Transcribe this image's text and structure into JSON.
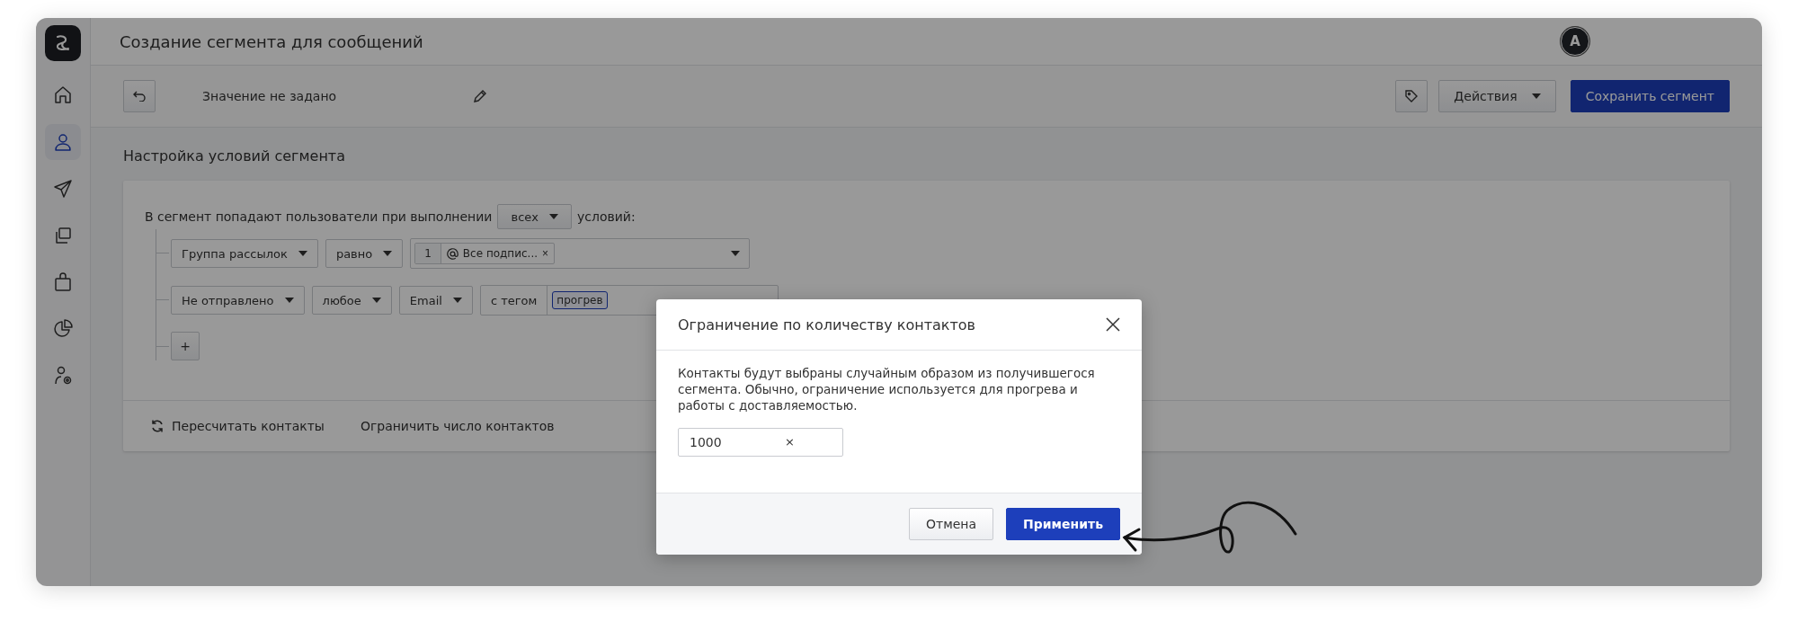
{
  "sidebar": {
    "items": [
      {
        "kind": "home",
        "selected": false
      },
      {
        "kind": "person",
        "selected": true
      },
      {
        "kind": "send",
        "selected": false
      },
      {
        "kind": "copies",
        "selected": false
      },
      {
        "kind": "bag",
        "selected": false
      },
      {
        "kind": "pie",
        "selected": false
      },
      {
        "kind": "person-gear",
        "selected": false
      }
    ]
  },
  "header": {
    "title": "Создание сегмента для сообщений",
    "avatar_initial": "A"
  },
  "toolbar": {
    "name_value": "Значение не задано",
    "actions_label": "Действия",
    "save_label": "Сохранить сегмент"
  },
  "section_title": "Настройка условий сегмента",
  "conditions": {
    "intro_before": "В сегмент попадают пользователи при выполнении",
    "match_select": "всех",
    "intro_after": "условий:",
    "rows": [
      {
        "fields": [
          {
            "kind": "select",
            "value": "Группа рассылок"
          },
          {
            "kind": "select",
            "value": "равно"
          },
          {
            "kind": "multiselect",
            "count": "1",
            "chip": "Все подпис...",
            "chip_remove": "×"
          }
        ]
      },
      {
        "fields": [
          {
            "kind": "select",
            "value": "Не отправлено"
          },
          {
            "kind": "select",
            "value": "любое"
          },
          {
            "kind": "select",
            "value": "Email"
          },
          {
            "kind": "tags",
            "label": "с тегом",
            "tags": [
              "прогрев"
            ]
          }
        ]
      }
    ],
    "add_label": "+"
  },
  "footer_actions": [
    {
      "kind": "recalc",
      "label": "Пересчитать контакты"
    },
    {
      "kind": "plain",
      "label": "Ограничить число контактов"
    }
  ],
  "modal": {
    "title": "Ограничение по количеству контактов",
    "text": "Контакты будут выбраны случайным образом из получившегося сегмента. Обычно, ограничение используется для прогрева и работы с доставляемостью.",
    "input_value": "1000",
    "clear": "×",
    "buttons": [
      {
        "label": "Отмена",
        "kind": "secondary"
      },
      {
        "label": "Применить",
        "kind": "primary"
      }
    ]
  }
}
